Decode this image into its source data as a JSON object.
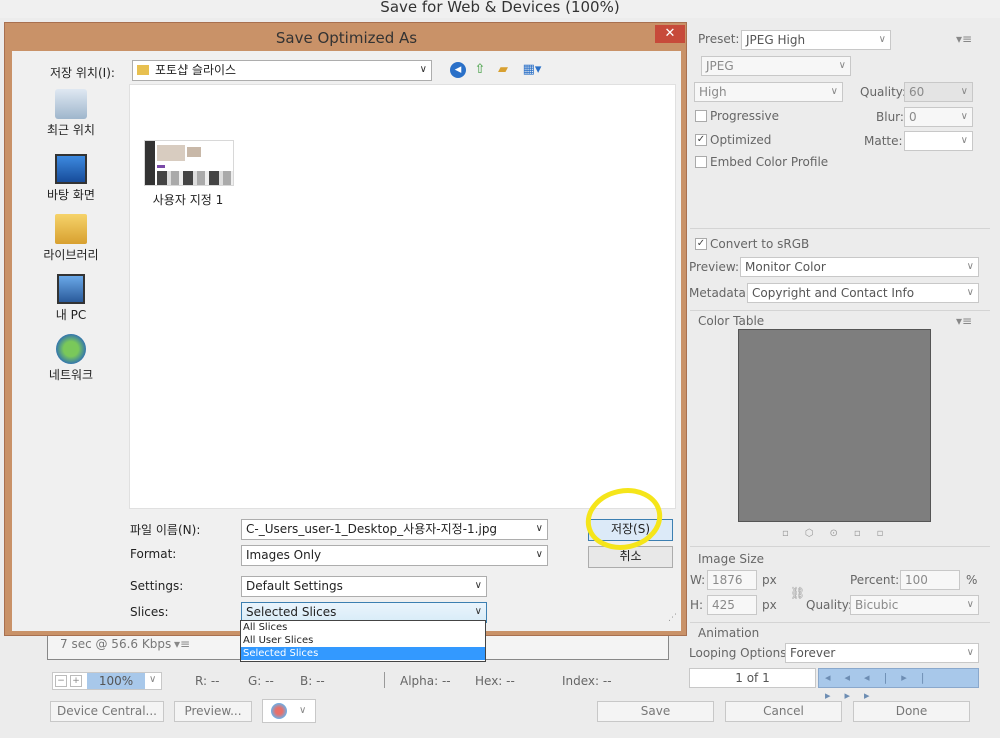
{
  "window": {
    "title": "Save for Web & Devices (100%)"
  },
  "right_panel": {
    "preset_label": "Preset:",
    "preset_value": "JPEG High",
    "format_value": "JPEG",
    "quality_level": "High",
    "quality_label": "Quality:",
    "quality_value": "60",
    "blur_label": "Blur:",
    "blur_value": "0",
    "matte_label": "Matte:",
    "progressive_label": "Progressive",
    "optimized_label": "Optimized",
    "embed_label": "Embed Color Profile",
    "convert_label": "Convert to sRGB",
    "preview_label": "Preview:",
    "preview_value": "Monitor Color",
    "metadata_label": "Metadata:",
    "metadata_value": "Copyright and Contact Info",
    "color_table_label": "Color Table",
    "image_size_label": "Image Size",
    "w_label": "W:",
    "w_value": "1876",
    "h_label": "H:",
    "h_value": "425",
    "px": "px",
    "percent_label": "Percent:",
    "percent_value": "100",
    "percent_unit": "%",
    "resample_label": "Quality:",
    "resample_value": "Bicubic",
    "animation_label": "Animation",
    "looping_label": "Looping Options:",
    "looping_value": "Forever",
    "frame_counter": "1 of 1"
  },
  "bottom_bar": {
    "speed": "7 sec @ 56.6 Kbps",
    "zoom": "100%",
    "r": "R: --",
    "g": "G: --",
    "b": "B: --",
    "alpha": "Alpha: --",
    "hex": "Hex: --",
    "index": "Index: --",
    "device_central": "Device Central...",
    "preview": "Preview...",
    "save": "Save",
    "cancel": "Cancel",
    "done": "Done"
  },
  "dialog": {
    "title": "Save Optimized As",
    "close": "✕",
    "location_label": "저장 위치(I):",
    "location_value": "포토샵 슬라이스",
    "places": [
      "최근 위치",
      "바탕 화면",
      "라이브러리",
      "내 PC",
      "네트워크"
    ],
    "file_item": "사용자 지정 1",
    "filename_label": "파일 이름(N):",
    "filename_value": "C-_Users_user-1_Desktop_사용자-지정-1.jpg",
    "format_label": "Format:",
    "format_value": "Images Only",
    "settings_label": "Settings:",
    "settings_value": "Default Settings",
    "slices_label": "Slices:",
    "slices_value": "Selected Slices",
    "save_button": "저장(S)",
    "cancel_button": "취소",
    "slices_options": [
      "All Slices",
      "All User Slices",
      "Selected Slices"
    ]
  }
}
